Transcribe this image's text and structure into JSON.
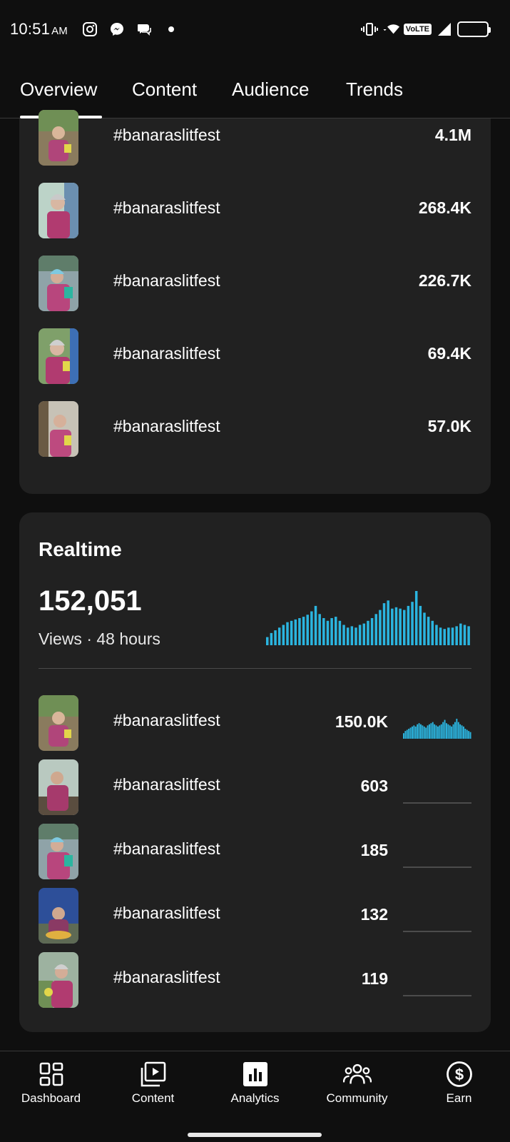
{
  "status_bar": {
    "time": "10:51",
    "ampm": "AM",
    "battery": "99",
    "network": "VoLTE"
  },
  "tabs": [
    {
      "label": "Overview",
      "active": true
    },
    {
      "label": "Content",
      "active": false
    },
    {
      "label": "Audience",
      "active": false
    },
    {
      "label": "Trends",
      "active": false
    }
  ],
  "top_content": {
    "items": [
      {
        "title": "#banaraslitfest",
        "value": "4.1M"
      },
      {
        "title": "#banaraslitfest",
        "value": "268.4K"
      },
      {
        "title": "#banaraslitfest",
        "value": "226.7K"
      },
      {
        "title": "#banaraslitfest",
        "value": "69.4K"
      },
      {
        "title": "#banaraslitfest",
        "value": "57.0K"
      }
    ]
  },
  "realtime": {
    "title": "Realtime",
    "views": "152,051",
    "subtitle": "Views · 48 hours",
    "accent_color": "#2bb5e0",
    "chart_data": {
      "type": "bar",
      "values": [
        12,
        18,
        22,
        26,
        30,
        34,
        36,
        38,
        40,
        42,
        45,
        50,
        58,
        46,
        40,
        36,
        40,
        42,
        36,
        30,
        26,
        28,
        26,
        30,
        32,
        36,
        40,
        46,
        52,
        62,
        66,
        54,
        56,
        54,
        52,
        58,
        64,
        80,
        58,
        48,
        42,
        36,
        30,
        26,
        24,
        26,
        26,
        28,
        32,
        30,
        28
      ]
    },
    "items": [
      {
        "title": "#banaraslitfest",
        "value": "150.0K",
        "spark": [
          10,
          14,
          16,
          18,
          20,
          22,
          24,
          22,
          26,
          28,
          26,
          24,
          22,
          20,
          24,
          26,
          28,
          30,
          26,
          24,
          22,
          24,
          26,
          30,
          34,
          28,
          26,
          24,
          22,
          26,
          30,
          36,
          30,
          26,
          24,
          22,
          18,
          16,
          14,
          12
        ],
        "flat": false
      },
      {
        "title": "#banaraslitfest",
        "value": "603",
        "spark": [],
        "flat": true
      },
      {
        "title": "#banaraslitfest",
        "value": "185",
        "spark": [],
        "flat": true
      },
      {
        "title": "#banaraslitfest",
        "value": "132",
        "spark": [],
        "flat": true
      },
      {
        "title": "#banaraslitfest",
        "value": "119",
        "spark": [],
        "flat": true
      }
    ]
  },
  "bottom_nav": [
    {
      "label": "Dashboard",
      "icon": "dashboard-icon",
      "active": false
    },
    {
      "label": "Content",
      "icon": "content-icon",
      "active": false
    },
    {
      "label": "Analytics",
      "icon": "analytics-icon",
      "active": true
    },
    {
      "label": "Community",
      "icon": "community-icon",
      "active": false
    },
    {
      "label": "Earn",
      "icon": "earn-icon",
      "active": false
    }
  ]
}
